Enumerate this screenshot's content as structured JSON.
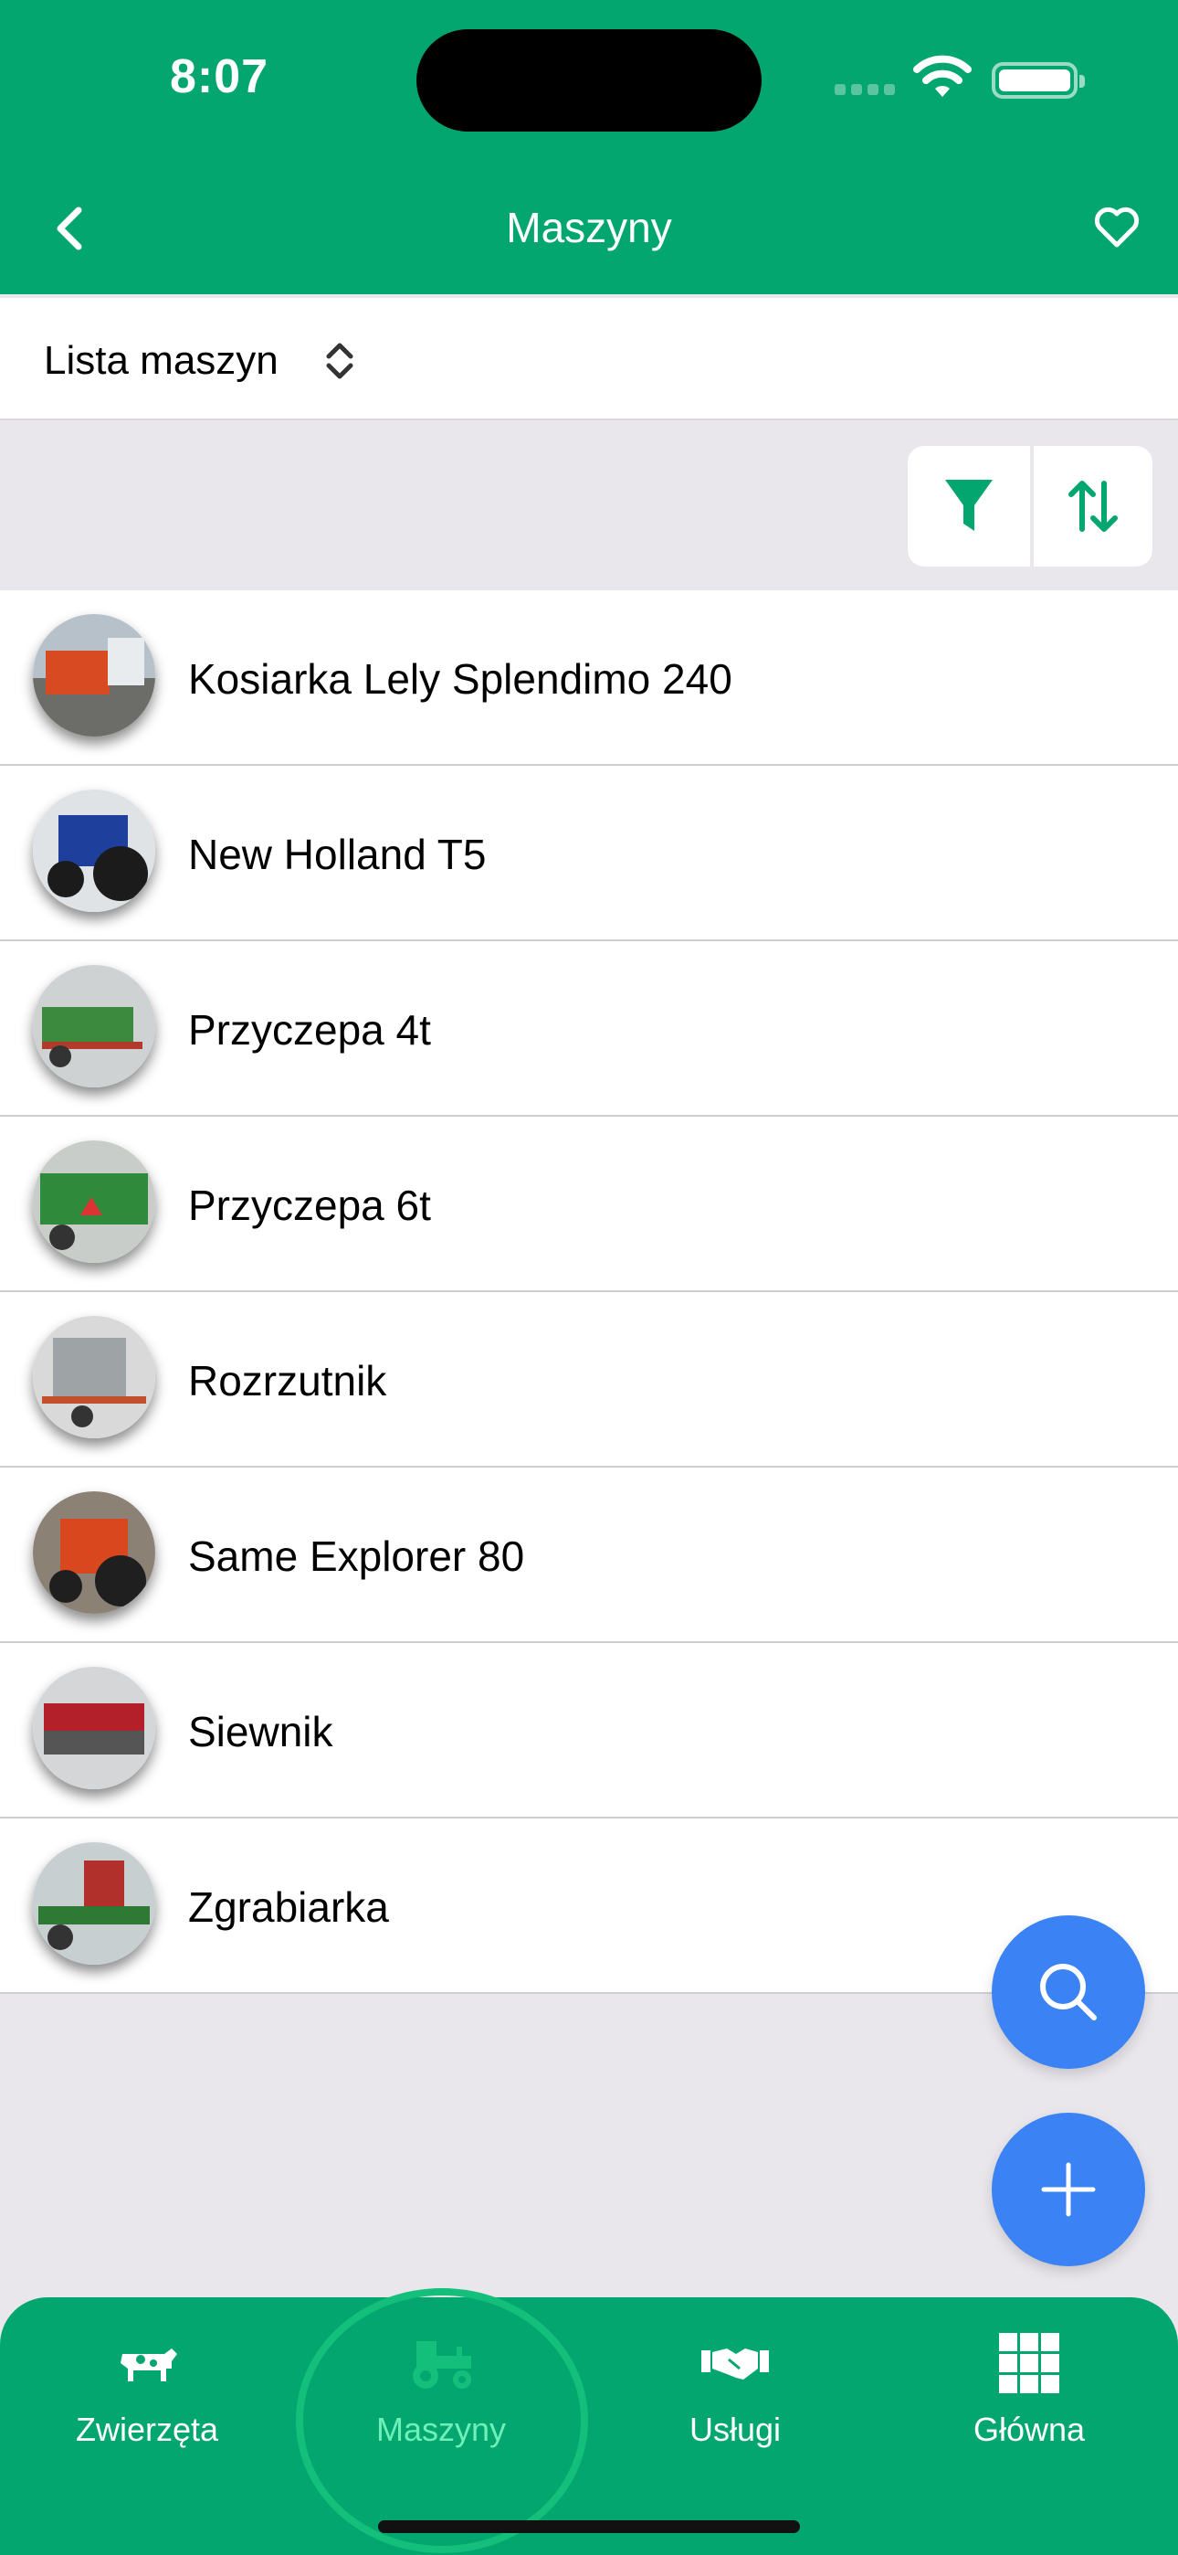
{
  "status": {
    "time": "8:07"
  },
  "nav": {
    "title": "Maszyny",
    "back_icon": "chevron-left-icon",
    "fav_icon": "heart-icon"
  },
  "selector": {
    "label": "Lista maszyn"
  },
  "machines": [
    {
      "name": "Kosiarka Lely Splendimo 240"
    },
    {
      "name": "New Holland T5"
    },
    {
      "name": "Przyczepa 4t"
    },
    {
      "name": "Przyczepa 6t"
    },
    {
      "name": "Rozrzutnik"
    },
    {
      "name": "Same Explorer 80"
    },
    {
      "name": "Siewnik"
    },
    {
      "name": "Zgrabiarka"
    }
  ],
  "tabs": [
    {
      "label": "Zwierzęta",
      "icon": "cow-icon"
    },
    {
      "label": "Maszyny",
      "icon": "tractor-icon",
      "active": true
    },
    {
      "label": "Usługi",
      "icon": "handshake-icon"
    },
    {
      "label": "Główna",
      "icon": "grid-icon"
    }
  ],
  "colors": {
    "primary": "#03a66e",
    "accent": "#3b82f4",
    "active_tab": "#6ff0b8",
    "background": "#e9e7ec"
  }
}
